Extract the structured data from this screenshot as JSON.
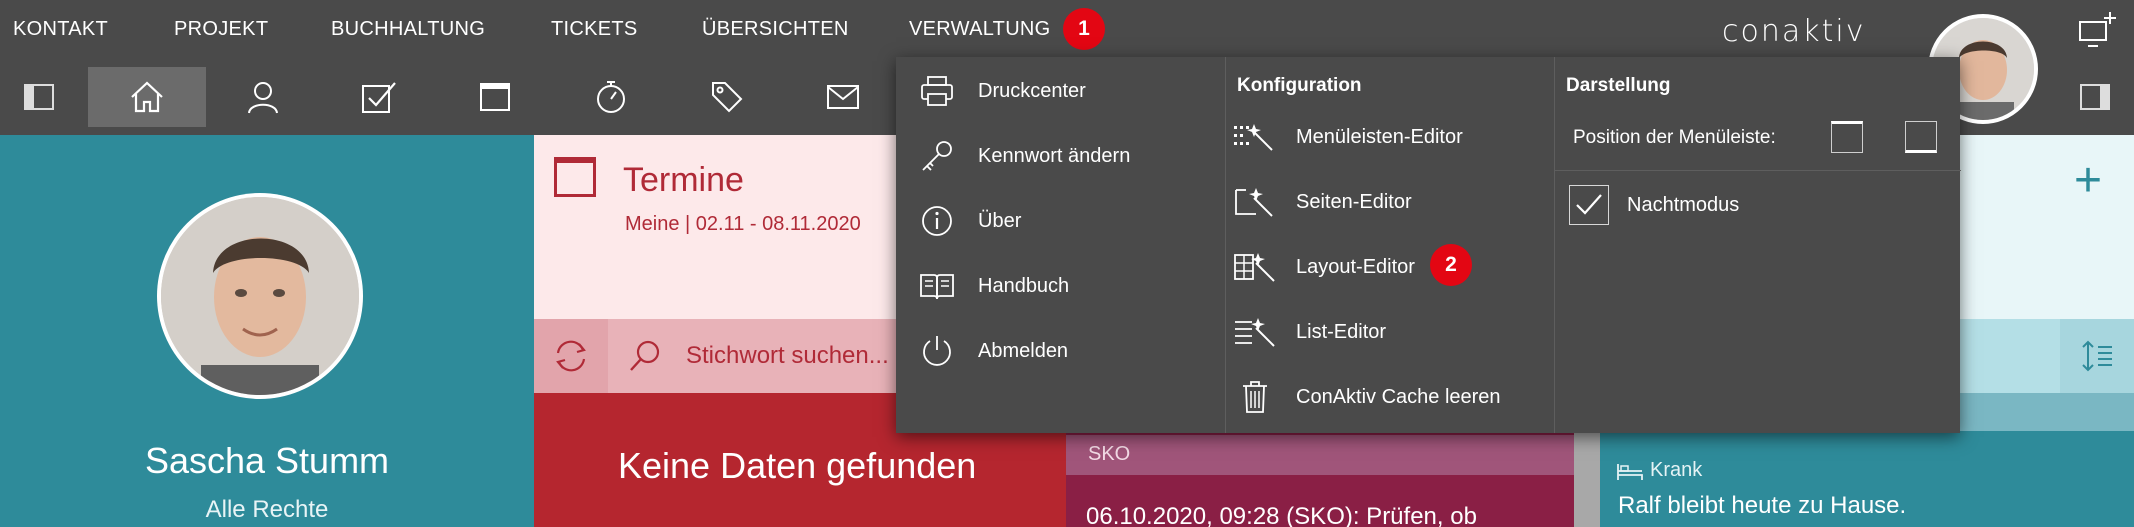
{
  "topnav": {
    "items": [
      "KONTAKT",
      "PROJEKT",
      "BUCHHALTUNG",
      "TICKETS",
      "ÜBERSICHTEN",
      "VERWALTUNG"
    ],
    "badge1": "1",
    "logo": "conaktiv"
  },
  "iconbar": {
    "icons": [
      "sidebar-toggle-icon",
      "home-icon",
      "person-icon",
      "checkbox-icon",
      "window-icon",
      "stopwatch-icon",
      "tag-icon",
      "mail-icon"
    ],
    "right_icon": "sidebar-right-icon"
  },
  "dropdown": {
    "col1": [
      "Druckcenter",
      "Kennwort ändern",
      "Über",
      "Handbuch",
      "Abmelden"
    ],
    "col2_header": "Konfiguration",
    "col2": [
      "Menüleisten-Editor",
      "Seiten-Editor",
      "Layout-Editor",
      "List-Editor",
      "ConAktiv Cache leeren"
    ],
    "badge2": "2",
    "col3_header": "Darstellung",
    "menu_position_label": "Position der Menüleiste:",
    "night_mode_label": "Nachtmodus",
    "night_mode_checked": true
  },
  "profile": {
    "name": "Sascha Stumm",
    "role": "Alle Rechte"
  },
  "termine": {
    "title": "Termine",
    "subtitle": "Meine | 02.11 - 08.11.2020",
    "search_placeholder": "Stichwort suchen...",
    "empty_text": "Keine Daten gefunden"
  },
  "sko": {
    "label": "SKO",
    "text": "06.10.2020, 09:28 (SKO): Prüfen, ob"
  },
  "rightpanel": {
    "status": "Krank",
    "text": "Ralf bleibt heute zu Hause."
  },
  "colors": {
    "nav_bg": "#4a4a4a",
    "teal": "#2e8b9a",
    "red": "#b5262f",
    "badge": "#e30613"
  }
}
